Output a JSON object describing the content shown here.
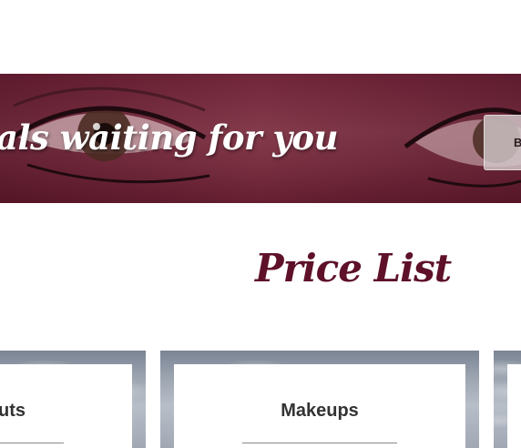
{
  "banner": {
    "tagline": "als waiting for you",
    "button_label": "B"
  },
  "price_list": {
    "title": "Price List"
  },
  "cards": [
    {
      "title": "uts"
    },
    {
      "title": "Makeups"
    },
    {
      "title": ""
    }
  ],
  "colors": {
    "title": "#5e1129",
    "banner_tint": "#6e2a3b",
    "card_text": "#333333"
  }
}
